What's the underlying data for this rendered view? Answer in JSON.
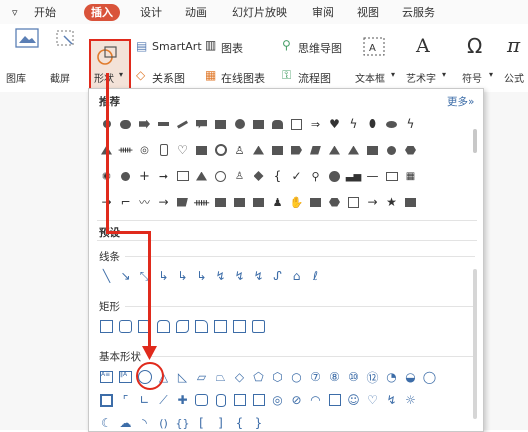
{
  "tabs": [
    "开始",
    "插入",
    "设计",
    "动画",
    "幻灯片放映",
    "审阅",
    "视图",
    "云服务"
  ],
  "active_tab": "插入",
  "ribbon": {
    "items": [
      {
        "label": "图库"
      },
      {
        "label": "截屏"
      },
      {
        "label": "形状"
      },
      {
        "label": "SmartArt"
      },
      {
        "label": "图表"
      },
      {
        "label": "思维导图"
      },
      {
        "label": "关系图"
      },
      {
        "label": "在线图表"
      },
      {
        "label": "流程图"
      },
      {
        "label": "文本框"
      },
      {
        "label": "艺术字"
      },
      {
        "label": "符号"
      },
      {
        "label": "公式"
      }
    ]
  },
  "panel": {
    "recommend_title": "推荐",
    "more_label": "更多»",
    "preset_title": "预设",
    "sections": [
      {
        "title": "线条"
      },
      {
        "title": "矩形"
      },
      {
        "title": "基本形状"
      }
    ]
  },
  "colors": {
    "accent": "#d9533a",
    "highlight": "#e02a1c",
    "outline": "#3d6da8"
  }
}
